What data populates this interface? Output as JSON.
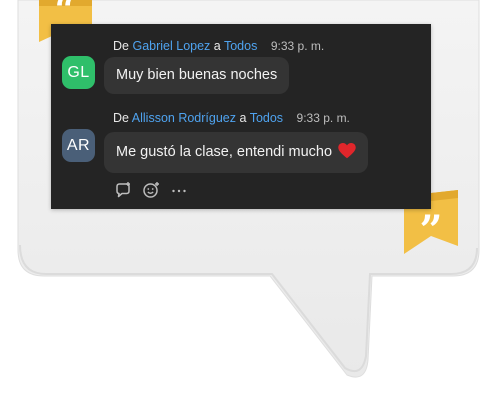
{
  "messages": [
    {
      "prefix": "De",
      "sender": "Gabriel Lopez",
      "connector": "a",
      "recipient": "Todos",
      "time": "9:33 p. m.",
      "initials": "GL",
      "avatar_color": "#2fbf6a",
      "text": "Muy bien buenas noches"
    },
    {
      "prefix": "De",
      "sender": "Allisson Rodríguez",
      "connector": "a",
      "recipient": "Todos",
      "time": "9:33 p. m.",
      "initials": "AR",
      "avatar_color": "#4a5f78",
      "text": "Me gustó la clase, entendi mucho",
      "emoji": "heart-icon"
    }
  ],
  "actions": {
    "reply_icon": "reply-icon",
    "reaction_icon": "add-reaction-icon",
    "more_icon": "more-options-icon"
  },
  "colors": {
    "panel_bg": "#242424",
    "bubble_bg": "#343434",
    "link_blue": "#4fa3ef",
    "quote_yellow": "#f2bf45",
    "heart_red": "#e0262b"
  }
}
